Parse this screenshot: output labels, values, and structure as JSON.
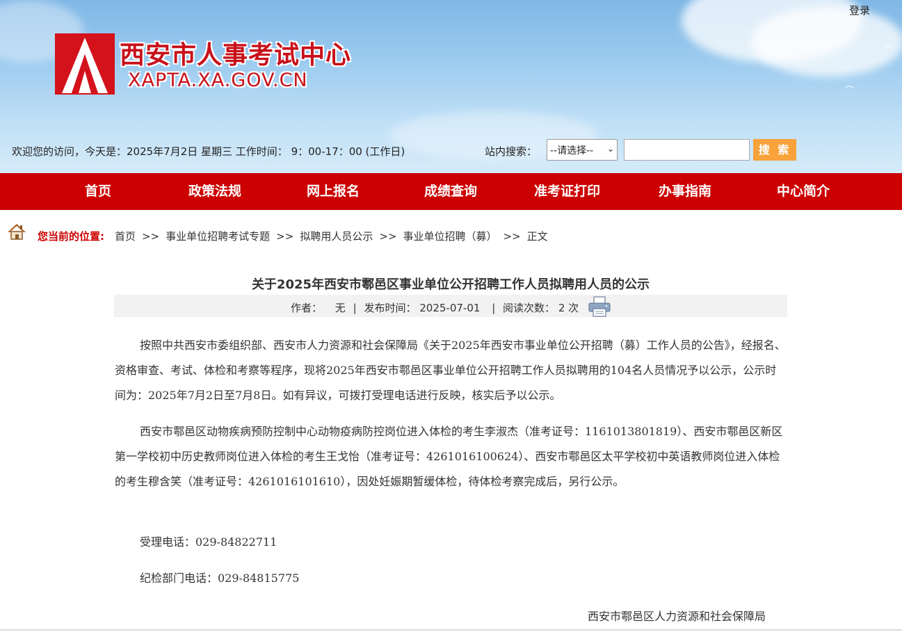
{
  "header": {
    "site_name": "西安市人事考试中心",
    "site_url": "XAPTA.XA.GOV.CN",
    "login_label": "登录",
    "welcome_text": "欢迎您的访问，今天是：2025年7月2日 星期三  工作时间：  9：00-17：00 (工作日)",
    "search_label": "站内搜索：",
    "select_value": "--请选择--",
    "search_input_value": "",
    "search_button": "搜 索",
    "brand_color": "#cc0000"
  },
  "nav": {
    "items": [
      "首页",
      "政策法规",
      "网上报名",
      "成绩查询",
      "准考证打印",
      "办事指南",
      "中心简介"
    ]
  },
  "breadcrumb": {
    "label": "您当前的位置:",
    "items": [
      "首页",
      "事业单位招聘考试专题",
      "拟聘用人员公示",
      "事业单位招聘（募）",
      "正文"
    ],
    "separator": ">>"
  },
  "article": {
    "title": "关于2025年西安市鄠邑区事业单位公开招聘工作人员拟聘用人员的公示",
    "meta": {
      "author_label": "作者：",
      "author": "无",
      "date_label": "发布时间：",
      "date": "2025-07-01",
      "reads_label": "阅读次数：",
      "reads": "2 次"
    },
    "paragraphs": [
      "按照中共西安市委组织部、西安市人力资源和社会保障局《关于2025年西安市事业单位公开招聘（募）工作人员的公告》，经报名、资格审查、考试、体检和考察等程序，现将2025年西安市鄠邑区事业单位公开招聘工作人员拟聘用的104名人员情况予以公示，公示时间为：2025年7月2日至7月8日。如有异议，可拨打受理电话进行反映，核实后予以公示。",
      "西安市鄠邑区动物疾病预防控制中心动物疫病防控岗位进入体检的考生李淑杰（准考证号：1161013801819）、西安市鄠邑区新区第一学校初中历史教师岗位进入体检的考生王戈怡（准考证号：4261016100624）、西安市鄠邑区太平学校初中英语教师岗位进入体检的考生穆含笑（准考证号：4261016101610），因处妊娠期暂缓体检，待体检考察完成后，另行公示。",
      "受理电话：029-84822711",
      "纪检部门电话：029-84815775"
    ],
    "signature": "西安市鄠邑区人力资源和社会保障局"
  }
}
